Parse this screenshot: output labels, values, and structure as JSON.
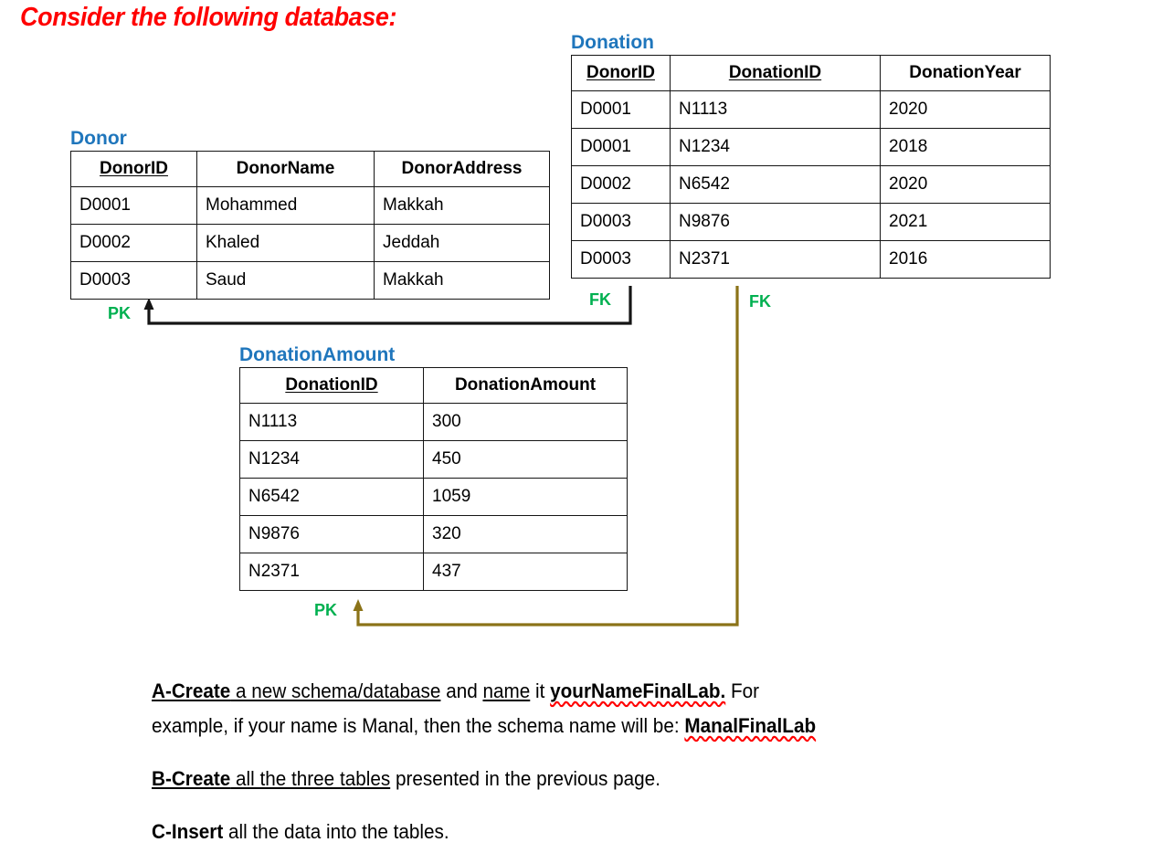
{
  "slide": {
    "title": "Consider the following database:"
  },
  "tables": {
    "donor": {
      "title": "Donor",
      "columns": [
        {
          "label": "DonorID",
          "key": "PK"
        },
        {
          "label": "DonorName",
          "key": ""
        },
        {
          "label": "DonorAddress",
          "key": ""
        }
      ],
      "rows": [
        [
          "D0001",
          "Mohammed",
          "Makkah"
        ],
        [
          "D0002",
          "Khaled",
          "Jeddah"
        ],
        [
          "D0003",
          "Saud",
          "Makkah"
        ]
      ]
    },
    "donation": {
      "title": "Donation",
      "columns": [
        {
          "label": "DonorID",
          "key": "FK"
        },
        {
          "label": "DonationID",
          "key": "FK"
        },
        {
          "label": "DonationYear",
          "key": ""
        }
      ],
      "rows": [
        [
          "D0001",
          "N1113",
          "2020"
        ],
        [
          "D0001",
          "N1234",
          "2018"
        ],
        [
          "D0002",
          "N6542",
          "2020"
        ],
        [
          "D0003",
          "N9876",
          "2021"
        ],
        [
          "D0003",
          "N2371",
          "2016"
        ]
      ]
    },
    "donation_amount": {
      "title": "DonationAmount",
      "columns": [
        {
          "label": "DonationID",
          "key": "PK"
        },
        {
          "label": "DonationAmount",
          "key": ""
        }
      ],
      "rows": [
        [
          "N1113",
          "300"
        ],
        [
          "N1234",
          "450"
        ],
        [
          "N6542",
          "1059"
        ],
        [
          "N9876",
          "320"
        ],
        [
          "N2371",
          "437"
        ]
      ]
    }
  },
  "keys": {
    "donor_pk": "PK",
    "donation_fk_donor": "FK",
    "donation_fk_donation": "FK",
    "donation_amount_pk": "PK"
  },
  "questions": [
    {
      "id": "A",
      "lines": [
        [
          {
            "t": "A-Create",
            "style": "bold-underline"
          },
          {
            "t": " a new schema/database",
            "style": "underline"
          },
          {
            "t": " and ",
            "style": "plain"
          },
          {
            "t": "name",
            "style": "underline"
          },
          {
            "t": " it ",
            "style": "plain"
          },
          {
            "t": "yourNameFinalLab.",
            "style": "bold-spell"
          },
          {
            "t": " For",
            "style": "plain"
          }
        ],
        [
          {
            "t": "example, if your name is Manal, then the schema name will be: ",
            "style": "plain"
          },
          {
            "t": "ManalFinalLab",
            "style": "bold-spell"
          }
        ]
      ]
    },
    {
      "id": "B",
      "lines": [
        [
          {
            "t": "B-Create",
            "style": "bold-underline"
          },
          {
            "t": " all the three tables",
            "style": "underline"
          },
          {
            "t": " presented in the previous page.",
            "style": "plain"
          }
        ]
      ]
    },
    {
      "id": "C",
      "lines": [
        [
          {
            "t": "C-Insert",
            "style": "bold"
          },
          {
            "t": " all the data into the tables.",
            "style": "plain"
          }
        ]
      ]
    }
  ],
  "colors": {
    "title_red": "#FF0000",
    "entity_blue": "#1F76BC",
    "key_green": "#00B050",
    "connector_black": "#151515",
    "connector_olive": "#8B7318",
    "border": "#151515",
    "spellcheck_red": "#FF0000"
  }
}
